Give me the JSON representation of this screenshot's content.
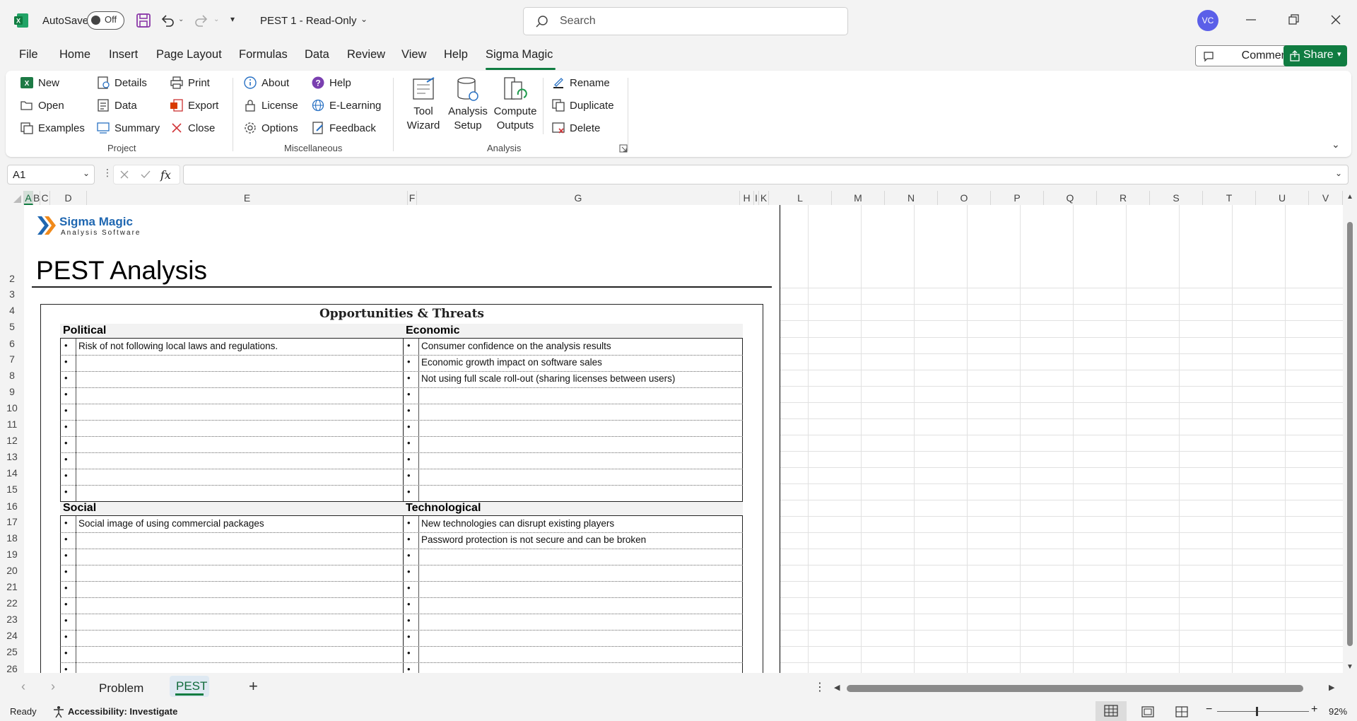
{
  "titlebar": {
    "autosave": "AutoSave",
    "toggle": "Off",
    "doc_title": "PEST 1  -  Read-Only",
    "search_placeholder": "Search",
    "avatar": "VC"
  },
  "tabs": [
    "File",
    "Home",
    "Insert",
    "Page Layout",
    "Formulas",
    "Data",
    "Review",
    "View",
    "Help",
    "Sigma Magic"
  ],
  "active_tab": "Sigma Magic",
  "buttons": {
    "comments": "Comments",
    "share": "Share"
  },
  "ribbon": {
    "project": {
      "new": "New",
      "open": "Open",
      "examples": "Examples",
      "details": "Details",
      "data": "Data",
      "summary": "Summary",
      "print": "Print",
      "export": "Export",
      "close": "Close",
      "group": "Project"
    },
    "misc": {
      "about": "About",
      "license": "License",
      "options": "Options",
      "help": "Help",
      "elearning": "E-Learning",
      "feedback": "Feedback",
      "group": "Miscellaneous"
    },
    "analysis": {
      "tool1": "Tool",
      "tool2": "Wizard",
      "setup1": "Analysis",
      "setup2": "Setup",
      "compute1": "Compute",
      "compute2": "Outputs",
      "rename": "Rename",
      "duplicate": "Duplicate",
      "delete": "Delete",
      "group": "Analysis"
    }
  },
  "formula_bar": {
    "name_box": "A1",
    "fx": "fx",
    "content": ""
  },
  "columns": [
    "A",
    "B",
    "C",
    "D",
    "E",
    "F",
    "G",
    "H",
    "I",
    "K",
    "L",
    "M",
    "N",
    "O",
    "P",
    "Q",
    "R",
    "S",
    "T",
    "U",
    "V"
  ],
  "rows": [
    "2",
    "3",
    "4",
    "5",
    "6",
    "7",
    "8",
    "9",
    "10",
    "11",
    "12",
    "13",
    "14",
    "15",
    "16",
    "17",
    "18",
    "19",
    "20",
    "21",
    "22",
    "23",
    "24",
    "25",
    "26"
  ],
  "sheet": {
    "logo_name": "Sigma Magic",
    "logo_sub": "Analysis Software",
    "title": "PEST Analysis",
    "box_title": "Opportunities & Threats",
    "political": {
      "header": "Political",
      "items": [
        "Risk of not following local laws and regulations.",
        "",
        "",
        "",
        "",
        "",
        "",
        "",
        "",
        ""
      ]
    },
    "economic": {
      "header": "Economic",
      "items": [
        "Consumer confidence on the analysis results",
        "Economic growth impact on software sales",
        "Not using full scale roll-out (sharing licenses between users)",
        "",
        "",
        "",
        "",
        "",
        "",
        ""
      ]
    },
    "social": {
      "header": "Social",
      "items": [
        "Social image of using commercial packages",
        "",
        "",
        "",
        "",
        "",
        "",
        "",
        "",
        ""
      ]
    },
    "technological": {
      "header": "Technological",
      "items": [
        "New technologies can disrupt existing players",
        "Password protection is not secure and can be broken",
        "",
        "",
        "",
        "",
        "",
        "",
        "",
        ""
      ]
    }
  },
  "sheet_tabs": [
    "Problem",
    "PEST"
  ],
  "active_sheet": "PEST",
  "status": {
    "ready": "Ready",
    "accessibility": "Accessibility: Investigate",
    "zoom": "92%"
  }
}
